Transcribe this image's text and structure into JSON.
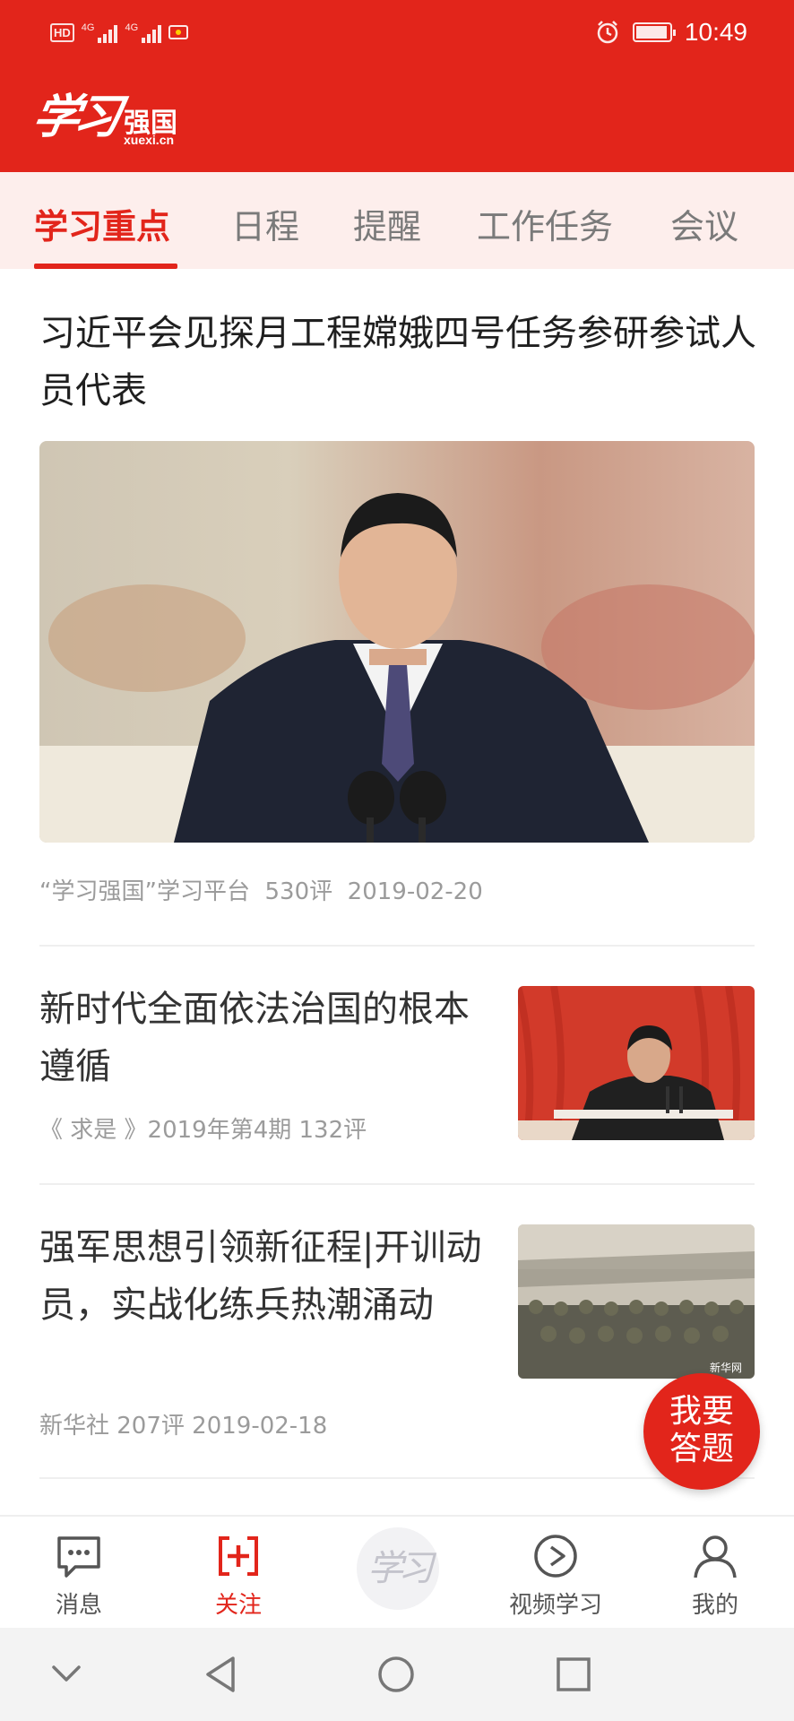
{
  "status_bar": {
    "left": {
      "hd": "HD",
      "net1": "4G",
      "net2": "4G"
    },
    "time": "10:49",
    "icons": [
      "alarm-icon",
      "battery-icon"
    ]
  },
  "header": {
    "logo_script": "学习",
    "logo_text": "强国",
    "logo_url": "xuexi.cn",
    "bg_color": "#e2251b"
  },
  "tabs": [
    {
      "label": "学习重点",
      "active": true
    },
    {
      "label": "日程",
      "active": false
    },
    {
      "label": "提醒",
      "active": false
    },
    {
      "label": "工作任务",
      "active": false
    },
    {
      "label": "会议",
      "active": false
    }
  ],
  "feed": {
    "top_story": {
      "title": "习近平会见探月工程嫦娥四号任务参研参试人员代表",
      "source": "“学习强国”学习平台",
      "comments": "530评",
      "date": "2019-02-20"
    },
    "items": [
      {
        "title": "新时代全面依法治国的根本遵循",
        "meta": "《 求是 》2019年第4期  132评"
      },
      {
        "title": "强军思想引领新征程|开训动员，实战化练兵热潮涌动",
        "meta": "新华社  207评  2019-02-18",
        "thumb_watermark": "新华网"
      }
    ]
  },
  "fab": {
    "line1": "我要",
    "line2": "答题"
  },
  "bottom_nav": [
    {
      "label": "消息",
      "icon": "message-icon",
      "active": false
    },
    {
      "label": "关注",
      "icon": "follow-icon",
      "active": true
    },
    {
      "label": "学习",
      "icon": "xuexi-logo-icon",
      "active": false
    },
    {
      "label": "视频学习",
      "icon": "video-play-icon",
      "active": false
    },
    {
      "label": "我的",
      "icon": "user-icon",
      "active": false
    }
  ],
  "system_nav": [
    "hide-icon",
    "back-icon",
    "home-icon",
    "recents-icon"
  ]
}
